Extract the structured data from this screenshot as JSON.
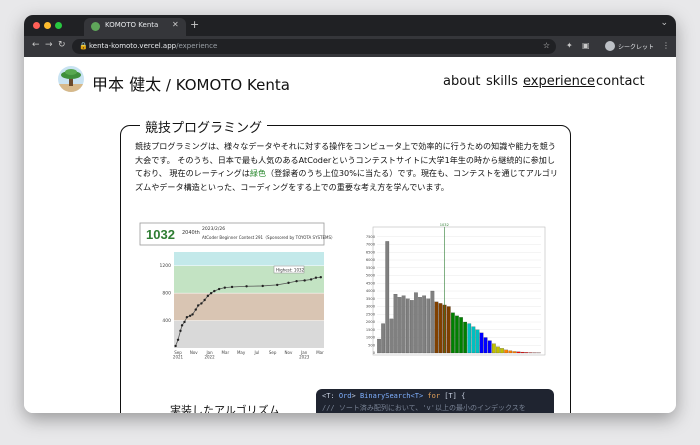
{
  "browser": {
    "tab_title": "KOMOTO Kenta",
    "url_host": "kenta-komoto.vercel.app",
    "url_path": "/experience",
    "incognito_label": "シークレット"
  },
  "site": {
    "name_jp": "甲本 健太",
    "name_sep": " / ",
    "name_en": "KOMOTO Kenta",
    "nav": [
      "about",
      "skills",
      "experience",
      "contact"
    ]
  },
  "section": {
    "title": "競技プログラミング",
    "para_1": "競技プログラミングは、様々なデータやそれに対する操作をコンピュータ上で効率的に行うための知識や能力を競う大会です。 そのうち、日本で最も人気のあるAtCoderというコンテストサイトに大学1年生の時から継続的に参加しており、 現在のレーティングは",
    "green_word": "緑色",
    "para_2": "（登録者のうち上位30%に当たる）です。現在も、コンテストを通じてアルゴリズムやデータ構造といった、コーディングをする上での重要な考え方を学んでいます。",
    "subheading": "実装したアルゴリズム"
  },
  "rating_card": {
    "rating": "1032",
    "rank": "2040th",
    "date": "2023/2/26",
    "contest": "AtCoder Beginner Contest 291（Sponsored by TOYOTA SYSTEMS）",
    "highest": "Highest: 1032"
  },
  "chart_data": [
    {
      "type": "line",
      "y_ticks": [
        400,
        800,
        1200
      ],
      "ylim": [
        0,
        1400
      ],
      "x_ticks": [
        "Sep 2021",
        "Nov",
        "Jan 2022",
        "Mar",
        "May",
        "Jul",
        "Sep",
        "Nov",
        "Jan 2023",
        "Mar"
      ],
      "bands": [
        {
          "from": 0,
          "to": 400,
          "color": "#d9d9d9"
        },
        {
          "from": 400,
          "to": 800,
          "color": "#d9c5b3"
        },
        {
          "from": 800,
          "to": 1200,
          "color": "#c3e3c3"
        },
        {
          "from": 1200,
          "to": 1400,
          "color": "#c3e9ea"
        }
      ],
      "x": [
        0.2,
        0.5,
        0.8,
        1.0,
        1.3,
        1.6,
        2.0,
        2.3,
        2.7,
        3.0,
        3.4,
        3.8,
        4.2,
        4.6,
        5.0,
        5.6,
        6.3,
        7.2,
        9.0,
        11.0,
        12.8,
        14.2,
        15.2,
        16.2,
        17.0,
        17.6,
        18.2
      ],
      "y": [
        30,
        120,
        250,
        330,
        380,
        450,
        470,
        490,
        560,
        620,
        650,
        700,
        760,
        800,
        830,
        860,
        880,
        890,
        900,
        905,
        920,
        950,
        975,
        985,
        1000,
        1025,
        1032
      ]
    },
    {
      "type": "bar",
      "y_ticks": [
        0,
        500,
        1000,
        1500,
        2000,
        2500,
        3000,
        3500,
        4000,
        4500,
        5000,
        5500,
        6000,
        6500,
        7000,
        7500
      ],
      "ylim": [
        0,
        8000
      ],
      "marker_label": "1032",
      "values": [
        900,
        1900,
        7200,
        2200,
        3800,
        3600,
        3700,
        3500,
        3400,
        3900,
        3600,
        3700,
        3500,
        4000,
        3300,
        3200,
        3100,
        3000,
        2600,
        2400,
        2300,
        2000,
        1900,
        1700,
        1500,
        1300,
        1000,
        800,
        600,
        400,
        300,
        200,
        150,
        100,
        80,
        60,
        40,
        30,
        20,
        10
      ],
      "colors": [
        "#808080",
        "#808080",
        "#808080",
        "#808080",
        "#808080",
        "#808080",
        "#808080",
        "#808080",
        "#808080",
        "#808080",
        "#808080",
        "#808080",
        "#808080",
        "#808080",
        "#804000",
        "#804000",
        "#804000",
        "#804000",
        "#008000",
        "#008000",
        "#008000",
        "#008000",
        "#00c0c0",
        "#00c0c0",
        "#00c0c0",
        "#0000ff",
        "#0000ff",
        "#0000ff",
        "#c0c000",
        "#c0c000",
        "#c0c000",
        "#ff8000",
        "#ff8000",
        "#ff8000",
        "#ff0000",
        "#ff0000",
        "#ff0000",
        "#ff0000",
        "#ff0000",
        "#ff0000"
      ]
    }
  ],
  "code": {
    "line1_a": "<T: ",
    "line1_b": "Ord",
    "line1_c": "> ",
    "line1_d": "BinarySearch<T>",
    "line1_e": " for ",
    "line1_f": "[T] {",
    "line2": "/// ソート済み配列において、'v'以上の最小のインデックスを"
  }
}
